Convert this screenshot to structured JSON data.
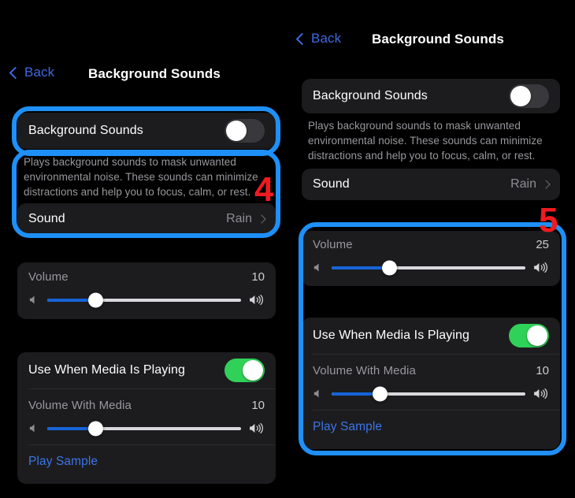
{
  "panels": {
    "left": {
      "nav": {
        "back_label": "Back",
        "title": "Background Sounds"
      },
      "bg_sounds": {
        "label": "Background Sounds",
        "toggle_state": "off"
      },
      "footnote": "Plays background sounds to mask unwanted environmental noise. These sounds can minimize distractions and help you to focus, calm, or rest.",
      "sound": {
        "label": "Sound",
        "value": "Rain"
      },
      "volume": {
        "label": "Volume",
        "value": "10",
        "percent": 25
      },
      "use_when_media": {
        "label": "Use When Media Is Playing",
        "toggle_state": "on"
      },
      "volume_with_media": {
        "label": "Volume With Media",
        "value": "10",
        "percent": 25
      },
      "play_sample": "Play Sample"
    },
    "right": {
      "nav": {
        "back_label": "Back",
        "title": "Background Sounds"
      },
      "bg_sounds": {
        "label": "Background Sounds",
        "toggle_state": "off"
      },
      "footnote": "Plays background sounds to mask unwanted environmental noise. These sounds can minimize distractions and help you to focus, calm, or rest.",
      "sound": {
        "label": "Sound",
        "value": "Rain"
      },
      "volume": {
        "label": "Volume",
        "value": "25",
        "percent": 30
      },
      "use_when_media": {
        "label": "Use When Media Is Playing",
        "toggle_state": "on"
      },
      "volume_with_media": {
        "label": "Volume With Media",
        "value": "10",
        "percent": 25
      },
      "play_sample": "Play Sample"
    }
  },
  "annotations": {
    "step4": "4",
    "step5": "5"
  },
  "icons": {
    "speaker_low": "speaker-low-icon",
    "speaker_high": "speaker-high-icon",
    "chevron_back": "chevron-left-icon",
    "chevron_right": "chevron-right-icon"
  },
  "colors": {
    "highlight": "#1e90f8",
    "marker": "#ef1b20",
    "toggle_on": "#30d158",
    "toggle_off": "#39393d",
    "slider_fill": "#1664d8",
    "link": "#3c75e8"
  }
}
